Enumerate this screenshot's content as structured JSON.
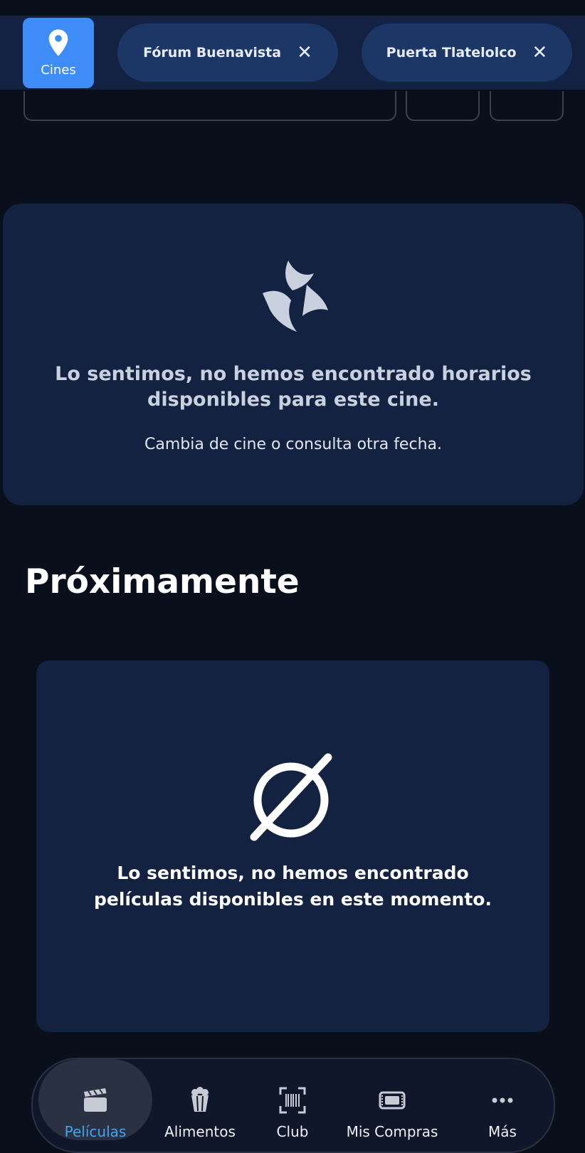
{
  "filter_bar": {
    "cines_label": "Cines",
    "chips": [
      {
        "label": "Fórum Buenavista",
        "close": "✕"
      },
      {
        "label": "Puerta Tlatelolco",
        "close": "✕"
      }
    ]
  },
  "showtimes_empty": {
    "title": "Lo sentimos, no hemos encontrado horarios disponibles para este cine.",
    "subtitle": "Cambia de cine o consulta otra fecha."
  },
  "upcoming": {
    "section_title": "Próximamente",
    "empty_title": "Lo sentimos, no hemos encontrado películas disponibles en este momento."
  },
  "bottom_nav": {
    "items": [
      {
        "label": "Películas",
        "icon": "clapperboard-icon",
        "active": true
      },
      {
        "label": "Alimentos",
        "icon": "popcorn-icon",
        "active": false
      },
      {
        "label": "Club",
        "icon": "barcode-scan-icon",
        "active": false
      },
      {
        "label": "Mis Compras",
        "icon": "ticket-icon",
        "active": false
      },
      {
        "label": "Más",
        "icon": "more-dots-icon",
        "active": false
      }
    ]
  },
  "colors": {
    "background": "#0a0f1c",
    "card": "#142241",
    "accent": "#3e8cf7",
    "active_nav_text": "#3ea6f4"
  }
}
